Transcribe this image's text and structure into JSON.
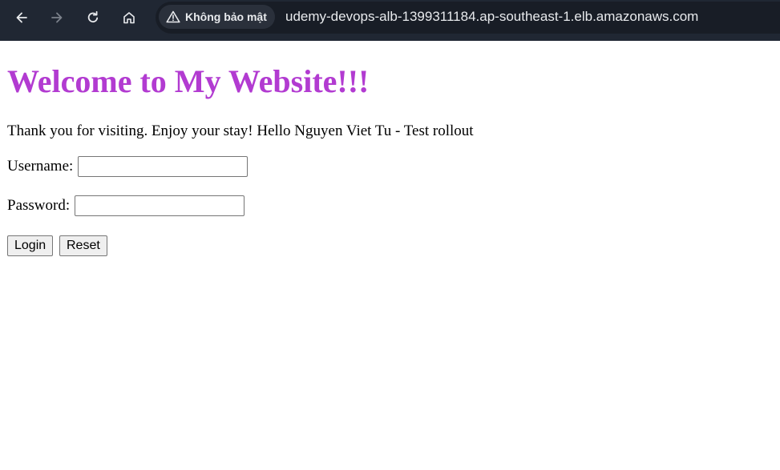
{
  "browser": {
    "security_chip_label": "Không bảo mật",
    "url": "udemy-devops-alb-1399311184.ap-southeast-1.elb.amazonaws.com",
    "colors": {
      "toolbar_bg": "#202733",
      "omnibox_bg": "#181d26",
      "chip_bg": "#2a303b",
      "text": "#e8eaed"
    }
  },
  "page": {
    "title": "Welcome to My Website!!!",
    "title_color": "#b23bd1",
    "intro": "Thank you for visiting. Enjoy your stay! Hello Nguyen Viet Tu - Test rollout",
    "form": {
      "username_label": "Username:",
      "username_value": "",
      "password_label": "Password:",
      "password_value": "",
      "login_label": "Login",
      "reset_label": "Reset"
    }
  }
}
